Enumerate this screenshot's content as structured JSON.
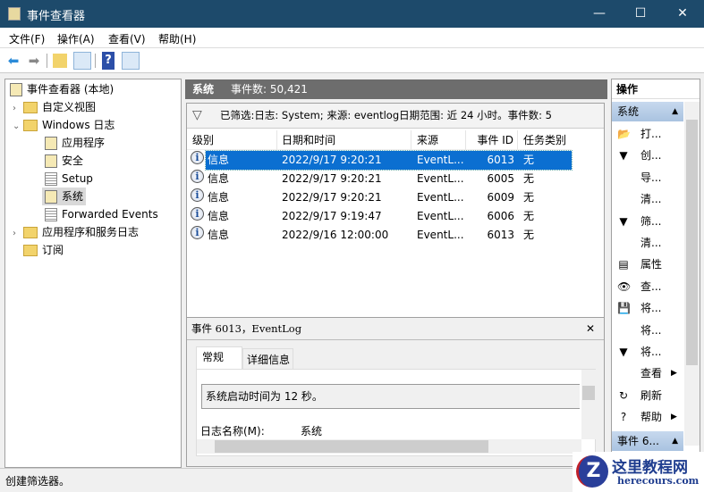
{
  "window": {
    "title": "事件查看器",
    "minimize": "—",
    "maximize": "☐",
    "close": "✕"
  },
  "menu": [
    "文件(F)",
    "操作(A)",
    "查看(V)",
    "帮助(H)"
  ],
  "tree": {
    "root": "事件查看器 (本地)",
    "items": [
      {
        "label": "自定义视图"
      },
      {
        "label": "Windows 日志"
      },
      {
        "label": "应用程序"
      },
      {
        "label": "安全"
      },
      {
        "label": "Setup"
      },
      {
        "label": "系统"
      },
      {
        "label": "Forwarded Events"
      },
      {
        "label": "应用程序和服务日志"
      },
      {
        "label": "订阅"
      }
    ]
  },
  "center": {
    "log_name": "系统",
    "event_count": "事件数: 50,421",
    "filter_text": "已筛选:日志: System; 来源: eventlog日期范围: 近 24 小时。事件数: 5",
    "columns": [
      "级别",
      "日期和时间",
      "来源",
      "事件 ID",
      "任务类别"
    ],
    "rows": [
      {
        "level": "信息",
        "date": "2022/9/17 9:20:21",
        "source": "EventL...",
        "id": "6013",
        "category": "无"
      },
      {
        "level": "信息",
        "date": "2022/9/17 9:20:21",
        "source": "EventL...",
        "id": "6005",
        "category": "无"
      },
      {
        "level": "信息",
        "date": "2022/9/17 9:20:21",
        "source": "EventL...",
        "id": "6009",
        "category": "无"
      },
      {
        "level": "信息",
        "date": "2022/9/17 9:19:47",
        "source": "EventL...",
        "id": "6006",
        "category": "无"
      },
      {
        "level": "信息",
        "date": "2022/9/16 12:00:00",
        "source": "EventL...",
        "id": "6013",
        "category": "无"
      }
    ],
    "details": {
      "title": "事件 6013，EventLog",
      "tabs": [
        "常规",
        "详细信息"
      ],
      "message": "系统启动时间为 12 秒。",
      "log_name_label": "日志名称(M):",
      "log_name_value": "系统"
    }
  },
  "actions": {
    "header": "操作",
    "section1": "系统",
    "items": [
      {
        "label": "打...",
        "icon": "📂"
      },
      {
        "label": "创...",
        "icon": "▼"
      },
      {
        "label": "导...",
        "icon": ""
      },
      {
        "label": "清...",
        "icon": ""
      },
      {
        "label": "筛...",
        "icon": "▼"
      },
      {
        "label": "清...",
        "icon": ""
      },
      {
        "label": "属性",
        "icon": "▤"
      },
      {
        "label": "查...",
        "icon": "👁"
      },
      {
        "label": "将...",
        "icon": "💾"
      },
      {
        "label": "将...",
        "icon": ""
      },
      {
        "label": "将...",
        "icon": "▼"
      },
      {
        "label": "查看",
        "icon": ""
      },
      {
        "label": "刷新",
        "icon": "↻"
      },
      {
        "label": "帮助",
        "icon": "?"
      }
    ],
    "section2": "事件 6..."
  },
  "status": "创建筛选器。",
  "watermark": {
    "title": "这里教程网",
    "url": "herecours.com"
  }
}
